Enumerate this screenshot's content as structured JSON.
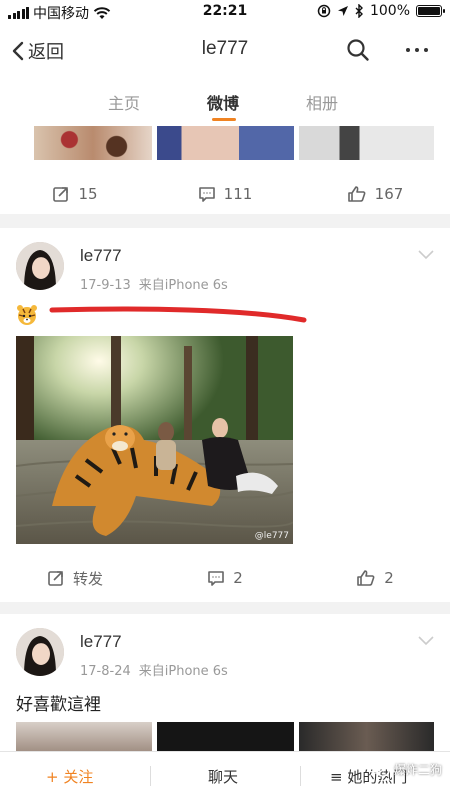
{
  "status_bar": {
    "carrier": "中国移动",
    "time": "22:21",
    "battery": "100%"
  },
  "nav": {
    "back_label": "返回",
    "title": "le777"
  },
  "tabs": [
    "主页",
    "微博",
    "相册"
  ],
  "previous_post": {
    "repost_count": "15",
    "comment_count": "111",
    "like_count": "167"
  },
  "posts": [
    {
      "username": "le777",
      "date": "17-9-13",
      "source": "来自iPhone 6s",
      "text": "",
      "photo_watermark": "@le777",
      "repost_label": "转发",
      "comment_count": "2",
      "like_count": "2"
    },
    {
      "username": "le777",
      "date": "17-8-24",
      "source": "来自iPhone 6s",
      "text": "好喜歡這裡"
    }
  ],
  "bottom_bar": {
    "follow": "+ 关注",
    "chat": "聊天",
    "hot": "≡ 她的热门"
  },
  "overlay_watermark": "爆炸二狗",
  "colors": {
    "accent": "#f08322",
    "highlight_underline": "#e02a2a"
  }
}
